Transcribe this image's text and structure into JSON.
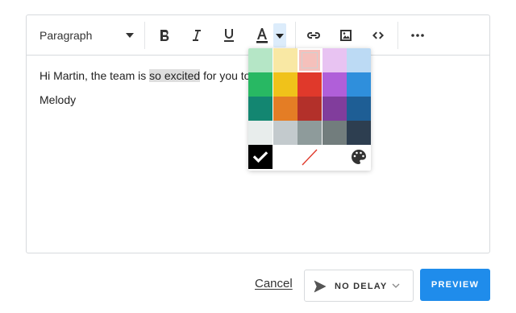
{
  "toolbar": {
    "paragraph_style": "Paragraph",
    "text_color_letter": "A"
  },
  "content": {
    "line1_prefix": "Hi Martin, the team is ",
    "line1_highlight": "so excited",
    "line1_suffix": " for you to s",
    "line2": "Melody"
  },
  "palette": {
    "colors": [
      "#b5e6c6",
      "#f9e8a4",
      "#f5c0bb",
      "#e8c3f2",
      "#bcdaf4",
      "#28b863",
      "#f0c21a",
      "#e0392b",
      "#b05fd9",
      "#2f8fdc",
      "#138671",
      "#e47d25",
      "#b3302a",
      "#813d9c",
      "#1e5e95",
      "#e8edec",
      "#c3cacd",
      "#8e9b9b",
      "#727d7d",
      "#2d3e50"
    ],
    "selected_index": 2,
    "accent_red": "#e0392b"
  },
  "footer": {
    "cancel_label": "Cancel",
    "delay_label": "NO DELAY",
    "preview_label": "PREVIEW",
    "preview_color": "#1f8ceb"
  }
}
